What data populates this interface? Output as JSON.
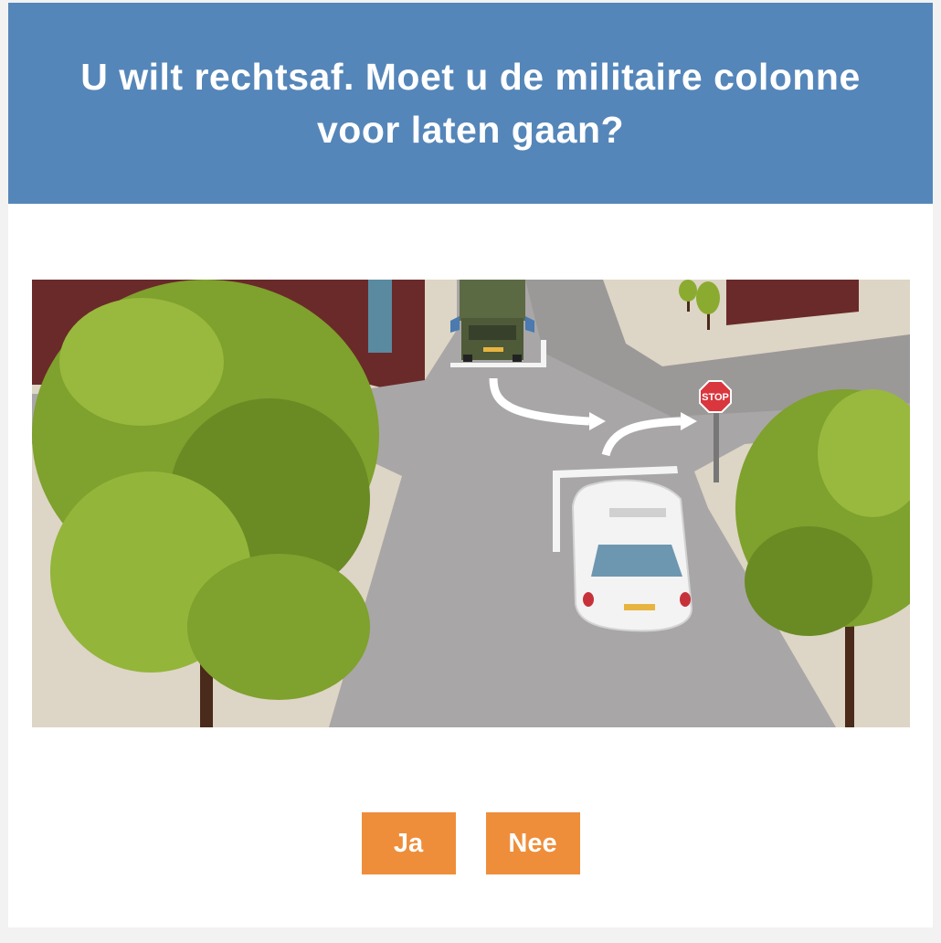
{
  "question": "U wilt rechtsaf. Moet u de militaire colonne voor laten gaan?",
  "scene": {
    "stop_sign_text": "STOP",
    "description_icon": "intersection-illustration"
  },
  "answers": {
    "yes_label": "Ja",
    "no_label": "Nee"
  },
  "colors": {
    "header_bg": "#5586b9",
    "button_bg": "#ee8e3a",
    "road": "#a9a6a7",
    "sidewalk": "#ddd5c5",
    "building": "#6a2a2a",
    "tree": "#8bab30"
  }
}
